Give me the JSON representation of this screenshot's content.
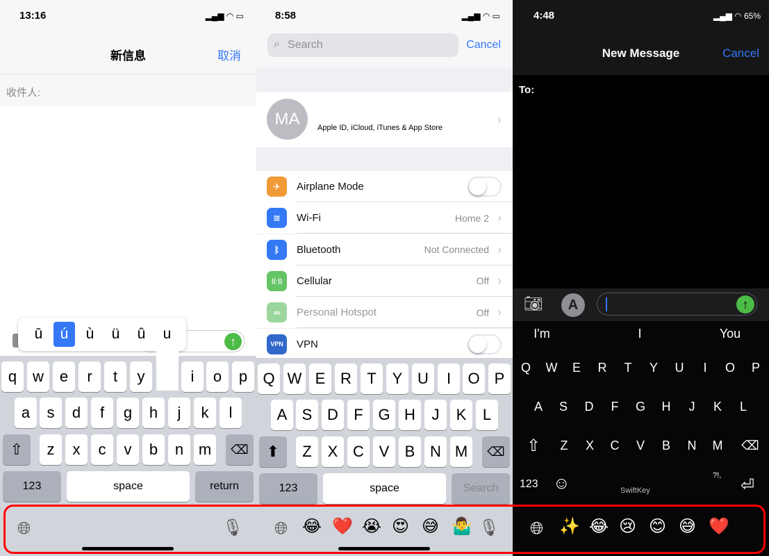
{
  "panel1": {
    "status_time": "13:16",
    "title": "新信息",
    "cancel": "取消",
    "to_label": "收件人:",
    "accent_popup": [
      "ū",
      "ú",
      "ù",
      "ü",
      "û",
      "u"
    ],
    "accent_selected": 1,
    "rows": [
      [
        "q",
        "w",
        "e",
        "r",
        "t",
        "y",
        "",
        "i",
        "o",
        "p"
      ],
      [
        "a",
        "s",
        "d",
        "f",
        "g",
        "h",
        "j",
        "k",
        "l"
      ],
      [
        "z",
        "x",
        "c",
        "v",
        "b",
        "n",
        "m"
      ]
    ],
    "num_key": "123",
    "space": "space",
    "return": "return",
    "icons": {
      "globe": "globe-icon",
      "mic": "microphone-icon"
    }
  },
  "panel2": {
    "status_time": "8:58",
    "search_placeholder": "Search",
    "cancel": "Cancel",
    "avatar_initials": "MA",
    "apple_id": "Apple ID, iCloud, iTunes & App Store",
    "settings": [
      {
        "label": "Airplane Mode",
        "value": "",
        "toggle": true,
        "color": "#f09a37",
        "icon": "✈"
      },
      {
        "label": "Wi-Fi",
        "value": "Home 2",
        "color": "#3478f6",
        "icon": "≋"
      },
      {
        "label": "Bluetooth",
        "value": "Not Connected",
        "color": "#3478f6",
        "icon": "ᛒ"
      },
      {
        "label": "Cellular",
        "value": "Off",
        "color": "#65c466",
        "icon": "((·))"
      },
      {
        "label": "Personal Hotspot",
        "value": "Off",
        "color": "#9bd69c",
        "icon": "∞",
        "dim": true
      },
      {
        "label": "VPN",
        "value": "",
        "toggle": true,
        "color": "#3068c9",
        "icon": "VPN"
      }
    ],
    "rows": [
      [
        "Q",
        "W",
        "E",
        "R",
        "T",
        "Y",
        "U",
        "I",
        "O",
        "P"
      ],
      [
        "A",
        "S",
        "D",
        "F",
        "G",
        "H",
        "J",
        "K",
        "L"
      ],
      [
        "Z",
        "X",
        "C",
        "V",
        "B",
        "N",
        "M"
      ]
    ],
    "num_key": "123",
    "space": "space",
    "search_key": "Search",
    "emoji_bar": [
      "😂",
      "❤️",
      "😭",
      "😍",
      "😅",
      "🤷‍♂️"
    ]
  },
  "panel3": {
    "status_time": "4:48",
    "battery": "65%",
    "title": "New Message",
    "cancel": "Cancel",
    "to_label": "To:",
    "suggestions": [
      "I'm",
      "I",
      "You"
    ],
    "rows": [
      [
        "Q",
        "W",
        "E",
        "R",
        "T",
        "Y",
        "U",
        "I",
        "O",
        "P"
      ],
      [
        "A",
        "S",
        "D",
        "F",
        "G",
        "H",
        "J",
        "K",
        "L"
      ],
      [
        "Z",
        "X",
        "C",
        "V",
        "B",
        "N",
        "M"
      ]
    ],
    "num_key": "123",
    "punct_key": "?!,",
    "brand": "SwiftKey",
    "emoji_bar": [
      "✨",
      "😂",
      "😢",
      "😊",
      "😅",
      "❤️"
    ]
  },
  "colors": {
    "accent": "#3478f6",
    "send": "#4cbb47",
    "highlight": "#ff0000"
  }
}
